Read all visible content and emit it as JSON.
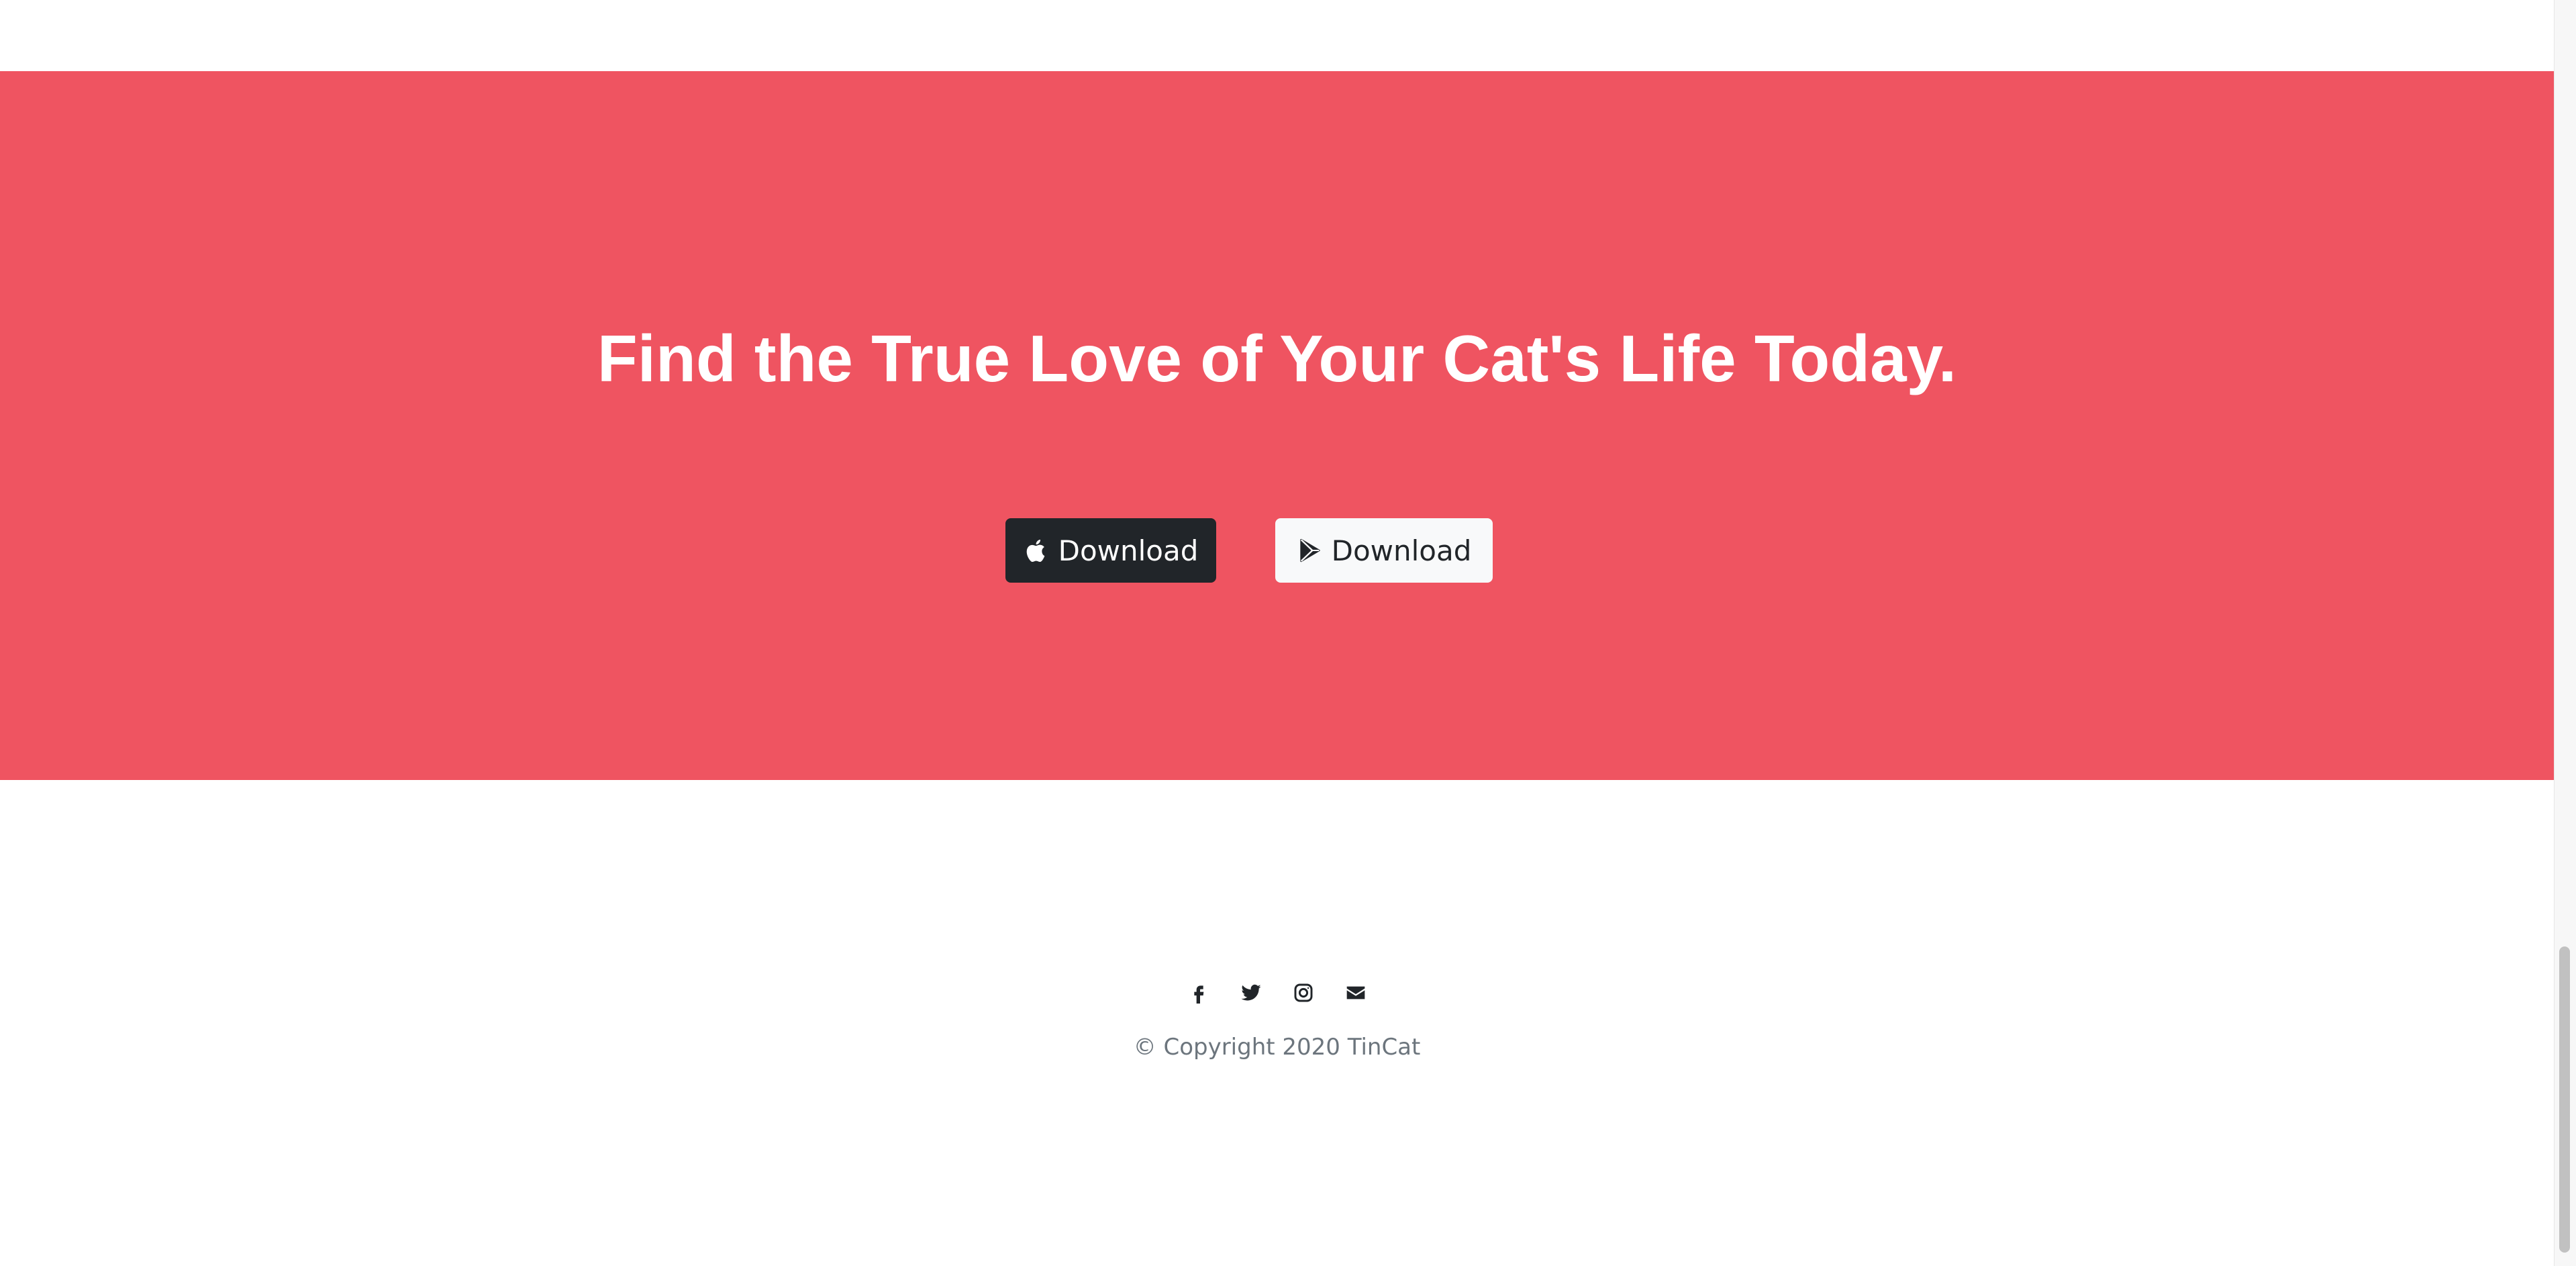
{
  "cta": {
    "title": "Find the True Love of Your Cat's Life Today.",
    "apple_button": {
      "label": "Download",
      "icon": "apple-icon"
    },
    "play_button": {
      "label": "Download",
      "icon": "google-play-icon"
    },
    "background_color": "#ef5461"
  },
  "footer": {
    "social_icons": [
      "facebook-icon",
      "twitter-icon",
      "instagram-icon",
      "envelope-icon"
    ],
    "copyright": "© Copyright 2020 TinCat"
  }
}
